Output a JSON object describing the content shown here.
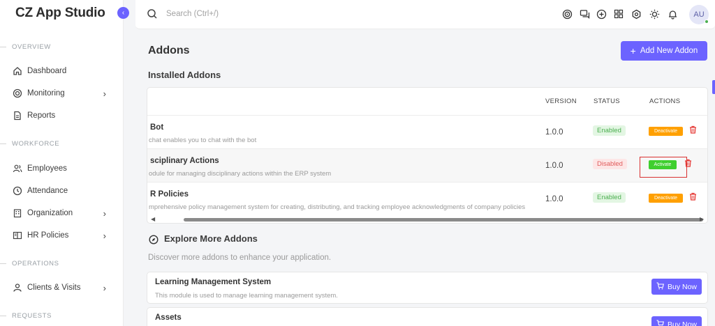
{
  "app": {
    "brand": "CZ App Studio",
    "collapse_icon": "chevron-left-icon"
  },
  "sidebar": {
    "sections": [
      {
        "label": "OVERVIEW"
      },
      {
        "label": "WORKFORCE"
      },
      {
        "label": "OPERATIONS"
      },
      {
        "label": "REQUESTS"
      }
    ],
    "items": [
      {
        "label": "Dashboard",
        "icon": "home-icon",
        "has_children": false
      },
      {
        "label": "Monitoring",
        "icon": "target-icon",
        "has_children": true
      },
      {
        "label": "Reports",
        "icon": "document-icon",
        "has_children": false
      },
      {
        "label": "Employees",
        "icon": "users-icon",
        "has_children": false
      },
      {
        "label": "Attendance",
        "icon": "clock-icon",
        "has_children": false
      },
      {
        "label": "Organization",
        "icon": "building-icon",
        "has_children": true
      },
      {
        "label": "HR Policies",
        "icon": "book-icon",
        "has_children": true
      },
      {
        "label": "Clients & Visits",
        "icon": "user-pin-icon",
        "has_children": true
      }
    ]
  },
  "topbar": {
    "search_placeholder": "Search (Ctrl+/)",
    "icons": [
      "target-icon",
      "chat-icon",
      "plus-circle-icon",
      "grid-icon",
      "settings-icon",
      "sun-icon",
      "bell-icon"
    ],
    "avatar_initials": "AU",
    "online_color": "#4caf50"
  },
  "page": {
    "title": "Addons",
    "add_button": "Add New Addon",
    "installed_title": "Installed Addons",
    "accent": "#6c63ff"
  },
  "table": {
    "headers": {
      "version": "VERSION",
      "status": "STATUS",
      "actions": "ACTIONS"
    },
    "rows": [
      {
        "title": "Bot",
        "desc": "chat enables you to chat with the bot",
        "version": "1.0.0",
        "status": "Enabled",
        "action": "Deactivate"
      },
      {
        "title": "sciplinary Actions",
        "desc": "odule for managing disciplinary actions within the ERP system",
        "version": "1.0.0",
        "status": "Disabled",
        "action": "Activate"
      },
      {
        "title": "R Policies",
        "desc": "mprehensive policy management system for creating, distributing, and tracking employee acknowledgments of company policies",
        "version": "1.0.0",
        "status": "Enabled",
        "action": "Deactivate"
      }
    ]
  },
  "explore": {
    "title": "Explore More Addons",
    "desc": "Discover more addons to enhance your application.",
    "cards": [
      {
        "title": "Learning Management System",
        "desc": "This module is used to manage learning management system.",
        "button": "Buy Now"
      },
      {
        "title": "Assets",
        "desc": "",
        "button": "Buy Now"
      }
    ]
  }
}
